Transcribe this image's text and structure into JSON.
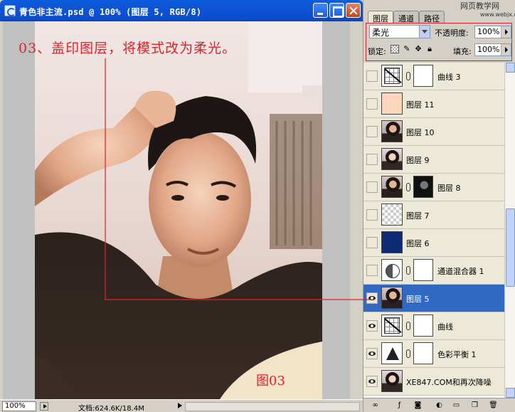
{
  "window": {
    "title": "青色非主流.psd @ 100% (图层 5, RGB/8)"
  },
  "annotation": {
    "text": "03、盖印图层，将模式改为柔光。",
    "figure_label": "图03",
    "color": "#e0222a"
  },
  "status": {
    "zoom": "100%",
    "doc_info": "文档:624.6K/18.4M"
  },
  "panel": {
    "tabs": [
      "图层",
      "通道",
      "路径"
    ],
    "watermark": "网页教学网",
    "watermark_sub": "www.webjx.com",
    "blend_mode": "柔光",
    "opacity_label": "不透明度:",
    "opacity_value": "100%",
    "lock_label": "锁定:",
    "fill_label": "填充:",
    "fill_value": "100%",
    "selection_color": "#316ac5"
  },
  "layers": [
    {
      "name": "曲线 3",
      "thumb": "curve",
      "mask": "white",
      "visible": false,
      "selected": false
    },
    {
      "name": "图层 11",
      "thumb": "peach",
      "mask": "none",
      "visible": false,
      "selected": false
    },
    {
      "name": "图层 10",
      "thumb": "portrait",
      "mask": "none",
      "visible": false,
      "selected": false
    },
    {
      "name": "图层 9",
      "thumb": "portrait",
      "mask": "none",
      "visible": false,
      "selected": false
    },
    {
      "name": "图层 8",
      "thumb": "portrait",
      "mask": "dark",
      "visible": false,
      "selected": false
    },
    {
      "name": "图层 7",
      "thumb": "checker",
      "mask": "none",
      "visible": false,
      "selected": false
    },
    {
      "name": "图层 6",
      "thumb": "navy",
      "mask": "none",
      "visible": false,
      "selected": false
    },
    {
      "name": "通道混合器 1",
      "thumb": "mixer",
      "mask": "white",
      "visible": false,
      "selected": false
    },
    {
      "name": "图层 5",
      "thumb": "portrait",
      "mask": "none",
      "visible": true,
      "selected": true
    },
    {
      "name": "曲线",
      "thumb": "curve",
      "mask": "white",
      "visible": true,
      "selected": false
    },
    {
      "name": "色彩平衡 1",
      "thumb": "balance",
      "mask": "white",
      "visible": true,
      "selected": false
    },
    {
      "name": "XE847.COM和再次降噪",
      "thumb": "portrait",
      "mask": "none",
      "visible": true,
      "selected": false
    }
  ]
}
